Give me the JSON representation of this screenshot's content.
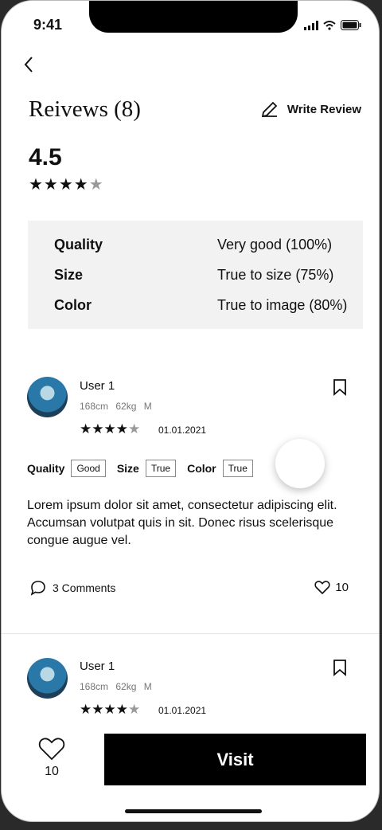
{
  "status": {
    "time": "9:41"
  },
  "header": {
    "title": "Reivews (8)",
    "write_review": "Write Review"
  },
  "overall": {
    "rating": "4.5",
    "stars": "★★★★★",
    "rating_value": 4.5
  },
  "summary": [
    {
      "label": "Quality",
      "value": "Very good (100%)"
    },
    {
      "label": "Size",
      "value": "True to size (75%)"
    },
    {
      "label": "Color",
      "value": "True to image (80%)"
    }
  ],
  "reviews": [
    {
      "user": "User 1",
      "meta": "168cm 62kg M",
      "stars": 4,
      "date": "01.01.2021",
      "attrs": [
        {
          "label": "Quality",
          "value": "Good"
        },
        {
          "label": "Size",
          "value": "True"
        },
        {
          "label": "Color",
          "value": "True"
        }
      ],
      "text": "Lorem ipsum dolor sit amet, consectetur adipiscing elit. Accumsan volutpat quis in sit. Donec risus scelerisque congue augue vel.",
      "comments": "3 Comments",
      "likes": "10"
    },
    {
      "user": "User 1",
      "meta": "168cm 62kg M",
      "stars": 4,
      "date": "01.01.2021"
    }
  ],
  "footer": {
    "likes": "10",
    "visit": "Visit"
  },
  "icons": [
    "back-icon",
    "pencil-icon",
    "bookmark-icon",
    "comment-icon",
    "heart-icon"
  ]
}
